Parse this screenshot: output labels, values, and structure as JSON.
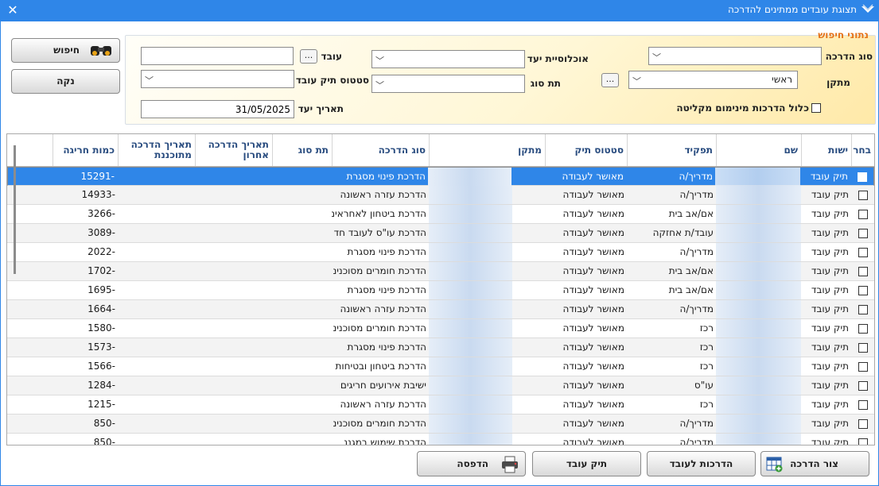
{
  "window": {
    "title": "תצוגת עובדים ממתינים להדרכה",
    "close_glyph": "✕"
  },
  "filters": {
    "legend": "נתוני חיפוש",
    "training_type": {
      "label": "סוג הדרכה",
      "value": ""
    },
    "facility": {
      "label": "מתקן",
      "value": "ראשי"
    },
    "target_population": {
      "label": "אוכלוסיית יעד",
      "value": ""
    },
    "sub_type": {
      "label": "תת סוג",
      "value": ""
    },
    "employee": {
      "label": "עובד",
      "value": ""
    },
    "employee_file_status": {
      "label": "סטטוס תיק עובד",
      "value": ""
    },
    "target_date": {
      "label": "תאריך יעד",
      "value": "31/05/2025"
    },
    "include_min_reception": {
      "label": "כלול הדרכות מינימום מקליטה",
      "checked": false
    },
    "dots": "..."
  },
  "buttons": {
    "search": "חיפוש",
    "clear": "נקה",
    "create_training": "צור הדרכה",
    "trainings_for_employee": "הדרכות לעובד",
    "employee_file": "תיק עובד",
    "print": "הדפסה"
  },
  "table": {
    "columns": [
      "בחר",
      "ישות",
      "שם",
      "תפקיד",
      "סטטוס תיק",
      "מתקן",
      "סוג הדרכה",
      "תת סוג",
      "תאריך הדרכה אחרון",
      "תאריך הדרכה מתוכננת",
      "כמות חריגה"
    ],
    "rows": [
      {
        "entity": "תיק עובד",
        "role": "מדריך/ה",
        "status": "מאושר לעבודה",
        "training": "הדרכת פינוי מסגרת",
        "over": "-15291"
      },
      {
        "entity": "תיק עובד",
        "role": "מדריך/ה",
        "status": "מאושר לעבודה",
        "training": "הדרכת עזרה ראשונה",
        "over": "-14933"
      },
      {
        "entity": "תיק עובד",
        "role": "אם/אב בית",
        "status": "מאושר לעבודה",
        "training": "הדרכת ביטחון לאחראינ",
        "over": "-3266"
      },
      {
        "entity": "תיק עובד",
        "role": "עובד/ת אחזקה",
        "status": "מאושר לעבודה",
        "training": "הדרכת עו\"ס לעובד חד",
        "over": "-3089"
      },
      {
        "entity": "תיק עובד",
        "role": "מדריך/ה",
        "status": "מאושר לעבודה",
        "training": "הדרכת פינוי מסגרת",
        "over": "-2022"
      },
      {
        "entity": "תיק עובד",
        "role": "אם/אב בית",
        "status": "מאושר לעבודה",
        "training": "הדרכת חומרים מסוכנינ",
        "over": "-1702"
      },
      {
        "entity": "תיק עובד",
        "role": "אם/אב בית",
        "status": "מאושר לעבודה",
        "training": "הדרכת פינוי מסגרת",
        "over": "-1695"
      },
      {
        "entity": "תיק עובד",
        "role": "מדריך/ה",
        "status": "מאושר לעבודה",
        "training": "הדרכת עזרה ראשונה",
        "over": "-1664"
      },
      {
        "entity": "תיק עובד",
        "role": "רכז",
        "status": "מאושר לעבודה",
        "training": "הדרכת חומרים מסוכנינ",
        "over": "-1580"
      },
      {
        "entity": "תיק עובד",
        "role": "רכז",
        "status": "מאושר לעבודה",
        "training": "הדרכת פינוי מסגרת",
        "over": "-1573"
      },
      {
        "entity": "תיק עובד",
        "role": "רכז",
        "status": "מאושר לעבודה",
        "training": "הדרכת ביטחון ובטיחות",
        "over": "-1566"
      },
      {
        "entity": "תיק עובד",
        "role": "עו\"ס",
        "status": "מאושר לעבודה",
        "training": "ישיבת אירועים חריגים",
        "over": "-1284"
      },
      {
        "entity": "תיק עובד",
        "role": "רכז",
        "status": "מאושר לעבודה",
        "training": "הדרכת עזרה ראשונה",
        "over": "-1215"
      },
      {
        "entity": "תיק עובד",
        "role": "מדריך/ה",
        "status": "מאושר לעבודה",
        "training": "הדרכת חומרים מסוכנינ",
        "over": "-850"
      },
      {
        "entity": "תיק עובד",
        "role": "מדריך/ה",
        "status": "מאושר לעבודה",
        "training": "הדרכת שימוש במגננ",
        "over": "-850"
      }
    ]
  }
}
